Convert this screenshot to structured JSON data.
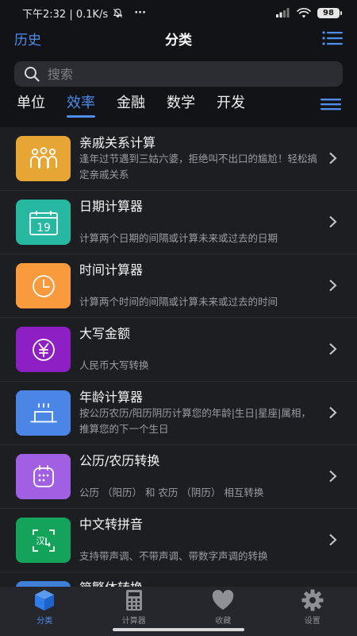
{
  "status_bar": {
    "time_network": "下午2:32 | 0.1K/s",
    "more": "···",
    "battery": "98"
  },
  "nav": {
    "left_label": "历史",
    "title": "分类"
  },
  "search": {
    "placeholder": "搜索"
  },
  "tabs": [
    "单位",
    "效率",
    "金融",
    "数学",
    "开发"
  ],
  "active_tab": "效率",
  "items": [
    {
      "title": "亲戚关系计算",
      "desc": "逢年过节遇到三姑六婆，拒绝叫不出口的尴尬！轻松搞定亲戚关系",
      "color": "#e7a533",
      "icon": "family-icon"
    },
    {
      "title": "日期计算器",
      "desc": "计算两个日期的间隔或计算未来或过去的日期",
      "color": "#27b8a1",
      "icon": "calendar-icon",
      "icon_text": "19"
    },
    {
      "title": "时间计算器",
      "desc": "计算两个时间的间隔或计算未来或过去的时间",
      "color": "#f99b3d",
      "icon": "clock-icon"
    },
    {
      "title": "大写金额",
      "desc": "人民币大写转换",
      "color": "#8e1fc4",
      "icon": "yuan-icon"
    },
    {
      "title": "年龄计算器",
      "desc": "按公历农历/阳历阴历计算您的年龄|生日|星座|属相，推算您的下一个生日",
      "color": "#4b86e6",
      "icon": "birthday-cake-icon"
    },
    {
      "title": "公历/农历转换",
      "desc": "公历 （阳历） 和 农历 （阴历） 相互转换",
      "color": "#a15fe3",
      "icon": "lunar-calendar-icon"
    },
    {
      "title": "中文转拼音",
      "desc": "支持带声调、不带声调、带数字声调的转换",
      "color": "#14a35a",
      "icon": "pinyin-icon",
      "icon_text": "汉"
    },
    {
      "title": "简繁体转换",
      "desc": "",
      "color": "#3f7fd6",
      "icon": "convert-icon"
    }
  ],
  "tab_bar": [
    {
      "label": "分类",
      "icon": "cube-icon",
      "active": true
    },
    {
      "label": "计算器",
      "icon": "calculator-icon",
      "active": false
    },
    {
      "label": "收藏",
      "icon": "heart-icon",
      "active": false
    },
    {
      "label": "设置",
      "icon": "gear-icon",
      "active": false
    }
  ],
  "colors": {
    "accent": "#4f8dea",
    "background": "#121316",
    "list_background": "#1d1e22",
    "tab_bar": "#26272c"
  }
}
